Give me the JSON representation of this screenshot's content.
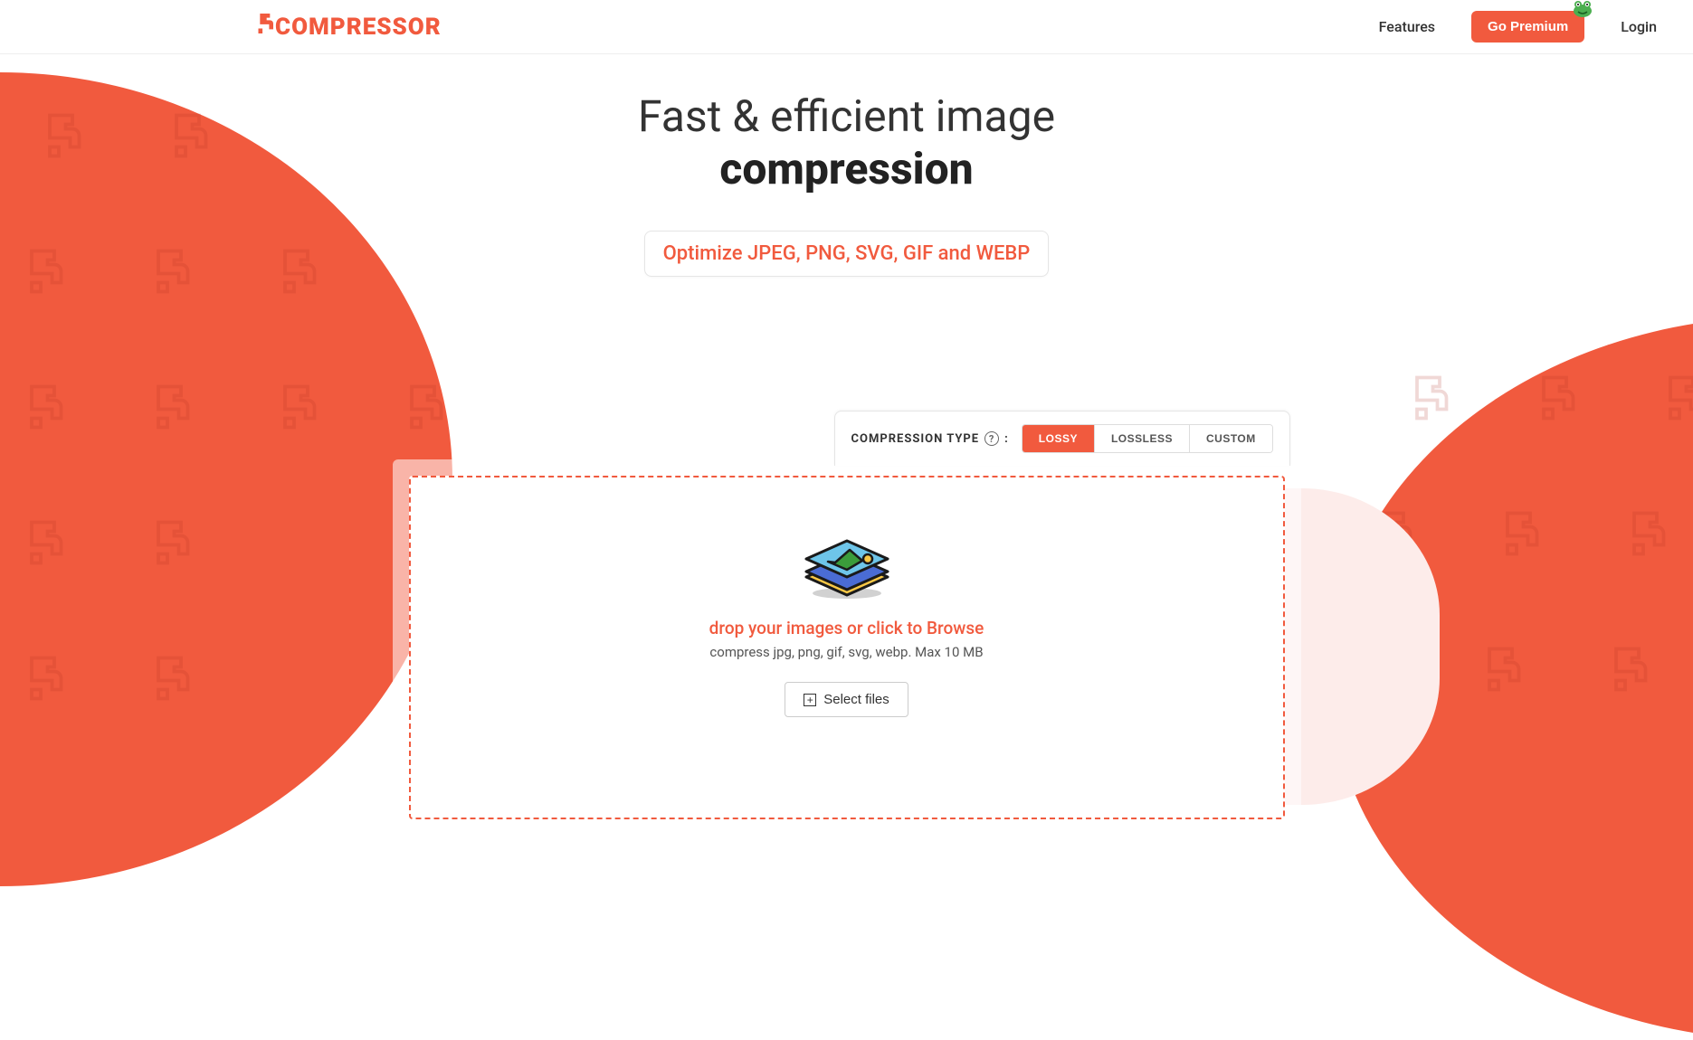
{
  "brand": "COMPRESSOR",
  "nav": {
    "features": "Features",
    "premium": "Go Premium",
    "login": "Login"
  },
  "hero": {
    "line1": "Fast & efficient image",
    "line2": "compression",
    "formats": "Optimize JPEG, PNG, SVG, GIF and WEBP"
  },
  "compression": {
    "label": "COMPRESSION TYPE",
    "colon": ":",
    "tabs": {
      "lossy": "LOSSY",
      "lossless": "LOSSLESS",
      "custom": "CUSTOM"
    }
  },
  "dropzone": {
    "title": "drop your images or click to Browse",
    "subtitle": "compress jpg, png, gif, svg, webp. Max 10 MB",
    "select": "Select files"
  },
  "colors": {
    "accent": "#f15a3e"
  }
}
